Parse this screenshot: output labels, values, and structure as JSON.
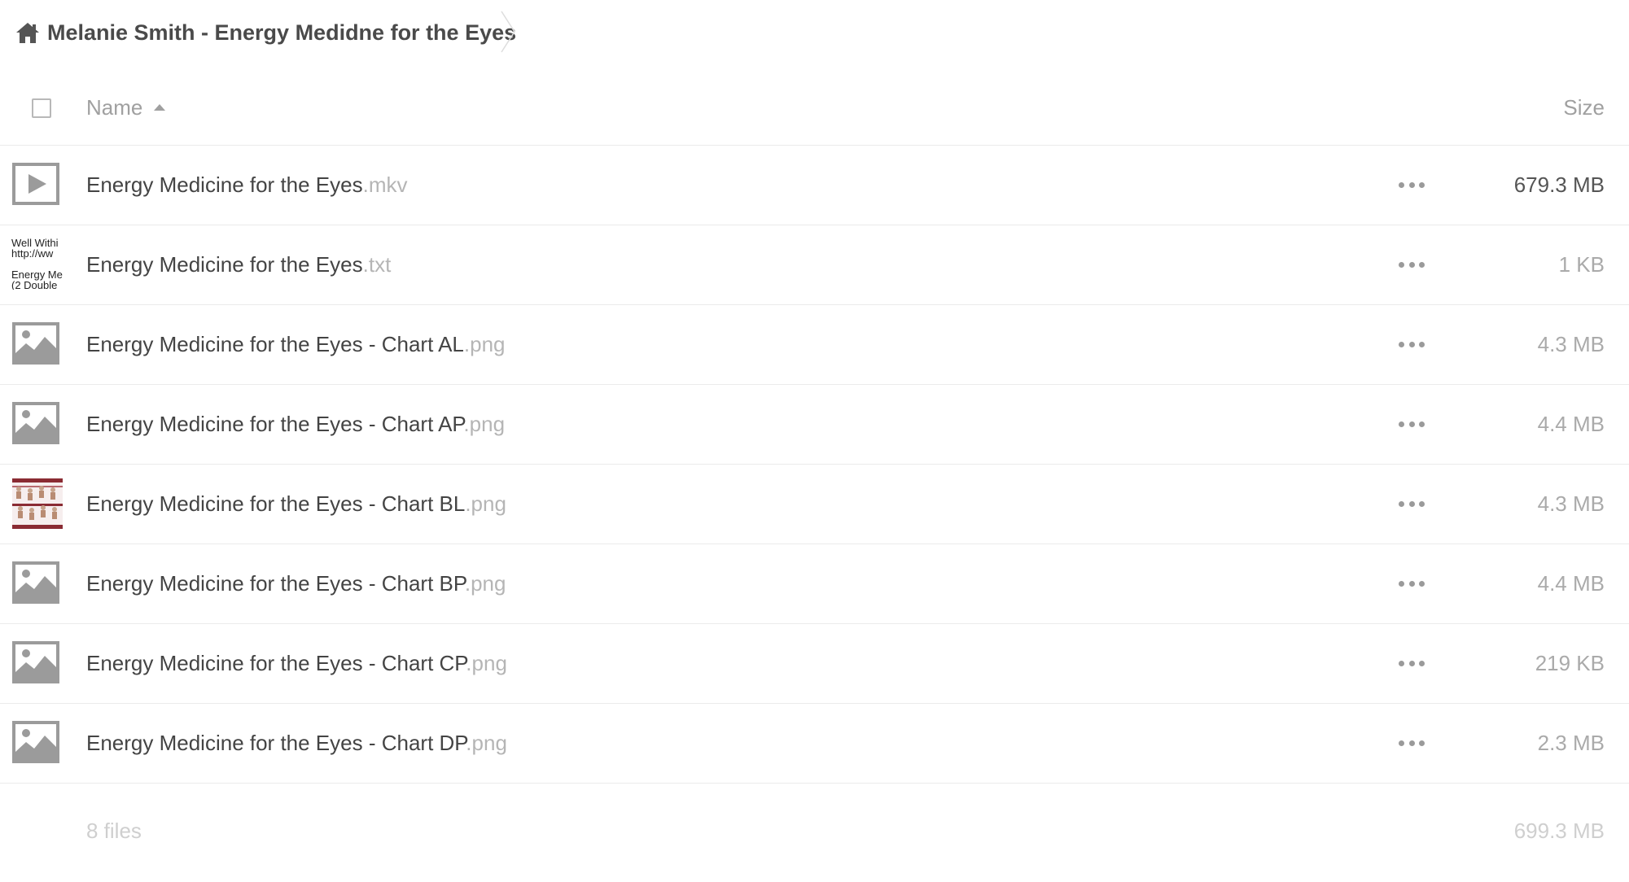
{
  "breadcrumb": {
    "home_icon": "home-icon",
    "title": "Melanie Smith - Energy Medidne for the Eyes",
    "separator_icon": "chevron-right-icon"
  },
  "list_header": {
    "name_label": "Name",
    "sort_icon": "sort-ascending-icon",
    "size_label": "Size"
  },
  "files": [
    {
      "base": "Energy Medicine for the Eyes",
      "ext": ".mkv",
      "size": "679.3 MB",
      "icon": "video-file-icon"
    },
    {
      "base": "Energy Medicine for the Eyes",
      "ext": ".txt",
      "size": "1 KB",
      "icon": "text-preview-thumbnail",
      "preview_lines": [
        "Well Withi",
        "http://ww",
        "",
        "Energy Me",
        "(2 Double"
      ]
    },
    {
      "base": "Energy Medicine for the Eyes - Chart AL",
      "ext": ".png",
      "size": "4.3 MB",
      "icon": "image-file-icon"
    },
    {
      "base": "Energy Medicine for the Eyes - Chart AP",
      "ext": ".png",
      "size": "4.4 MB",
      "icon": "image-file-icon"
    },
    {
      "base": "Energy Medicine for the Eyes - Chart BL",
      "ext": ".png",
      "size": "4.3 MB",
      "icon": "chart-preview-thumbnail"
    },
    {
      "base": "Energy Medicine for the Eyes - Chart BP",
      "ext": ".png",
      "size": "4.4 MB",
      "icon": "image-file-icon"
    },
    {
      "base": "Energy Medicine for the Eyes - Chart CP",
      "ext": ".png",
      "size": "219 KB",
      "icon": "image-file-icon"
    },
    {
      "base": "Energy Medicine for the Eyes - Chart DP",
      "ext": ".png",
      "size": "2.3 MB",
      "icon": "image-file-icon"
    }
  ],
  "row_actions_icon": "more-options-icon",
  "summary": {
    "count": "8 files",
    "total_size": "699.3 MB"
  },
  "colors": {
    "text": "#444444",
    "muted": "#aaaaaa",
    "extension": "#b5b5b5",
    "icon": "#9b9b9b",
    "divider": "#ebebeb"
  }
}
